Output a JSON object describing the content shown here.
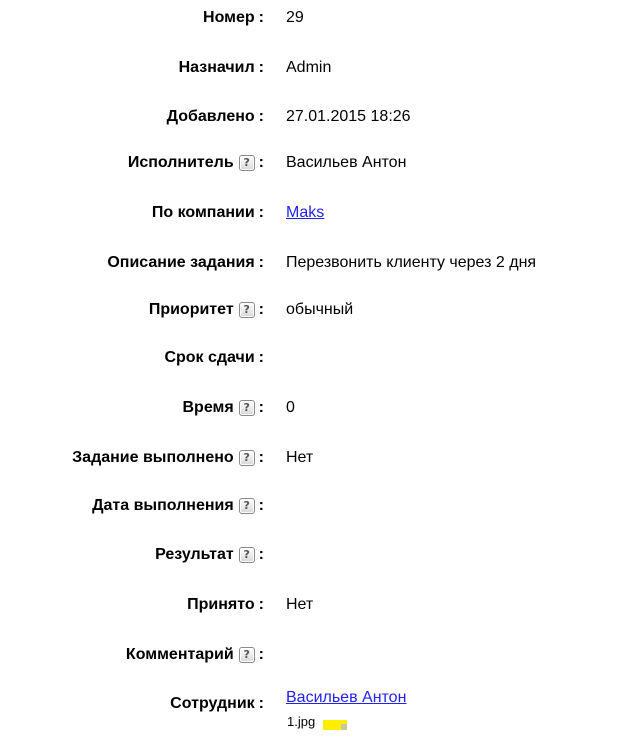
{
  "fields": {
    "number": {
      "label": "Номер",
      "value": "29"
    },
    "assigned_by": {
      "label": "Назначил",
      "value": "Admin"
    },
    "added": {
      "label": "Добавлено",
      "value": "27.01.2015 18:26"
    },
    "executor": {
      "label": "Исполнитель",
      "value": "Васильев Антон"
    },
    "company": {
      "label": "По компании",
      "value": "Maks"
    },
    "description": {
      "label": "Описание задания",
      "value": "Перезвонить клиенту через 2 дня"
    },
    "priority": {
      "label": "Приоритет",
      "value": "обычный"
    },
    "deadline": {
      "label": "Срок сдачи",
      "value": ""
    },
    "time": {
      "label": "Время",
      "value": "0"
    },
    "done": {
      "label": "Задание выполнено",
      "value": "Нет"
    },
    "done_date": {
      "label": "Дата выполнения",
      "value": ""
    },
    "result": {
      "label": "Результат",
      "value": ""
    },
    "accepted": {
      "label": "Принято",
      "value": "Нет"
    },
    "comment": {
      "label": "Комментарий",
      "value": ""
    },
    "employee": {
      "label": "Сотрудник",
      "value": "Васильев Антон"
    }
  },
  "colon": ":",
  "help_icon_glyph": "?",
  "attachment": {
    "filename": "1.jpg",
    "thumb_color": "#ffee00"
  },
  "link_color": "#2222ee"
}
